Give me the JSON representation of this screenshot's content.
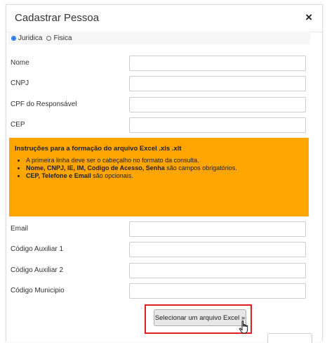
{
  "modal": {
    "title": "Cadastrar Pessoa",
    "close_glyph": "×"
  },
  "person_type": {
    "options": [
      {
        "label": "Juridica",
        "checked": true
      },
      {
        "label": "Fisica",
        "checked": false
      }
    ]
  },
  "fields_top": [
    {
      "label": "Nome",
      "value": ""
    },
    {
      "label": "CNPJ",
      "value": ""
    },
    {
      "label": "CPF do Responsável",
      "value": ""
    },
    {
      "label": "CEP",
      "value": ""
    }
  ],
  "instructions": {
    "title": "Instruções para a formação do arquivo Excel .xls .xlt",
    "item1": "A primeira linha deve ser o cabeçalho no formato da consulta.",
    "item2_bold": "Nome, CNPJ, IE, IM, Codigo de Acesso, Senha",
    "item2_rest": " são campos obrigatórios.",
    "item3_bold": "CEP, Telefone e Email",
    "item3_rest": " são opcionais.",
    "background": "#ffa500"
  },
  "fields_bottom": [
    {
      "label": "Email",
      "value": ""
    },
    {
      "label": "Código Auxiliar 1",
      "value": ""
    },
    {
      "label": "Código Auxiliar 2",
      "value": ""
    },
    {
      "label": "Código Municipio",
      "value": ""
    }
  ],
  "excel_button": {
    "label": "Selecionar um arquivo Excel »",
    "highlight_color": "#e02020"
  },
  "icons": {
    "close": "close-icon",
    "cursor": "hand-pointer-icon"
  }
}
